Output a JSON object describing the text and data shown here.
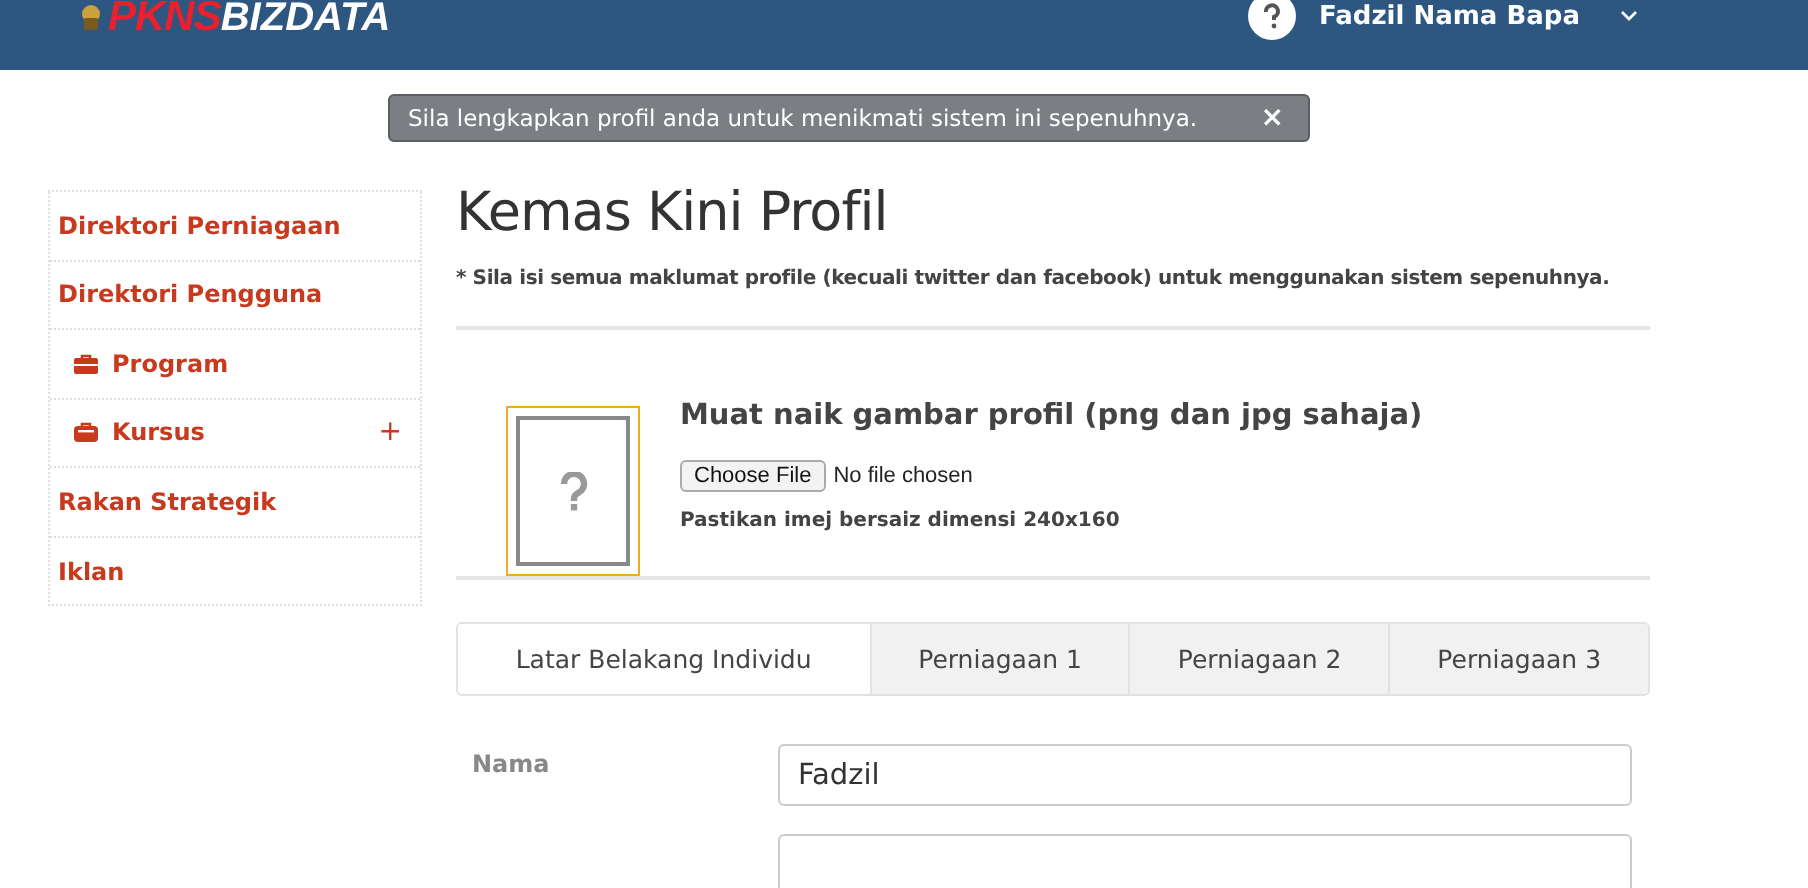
{
  "header": {
    "logo": {
      "brand": "PKNS",
      "product": "BIZDATA"
    },
    "user": {
      "name": "Fadzil Nama Bapa"
    }
  },
  "alert": {
    "message": "Sila lengkapkan profil anda untuk menikmati sistem ini sepenuhnya.",
    "close": "×"
  },
  "sidebar": {
    "items": [
      {
        "label": "Direktori Perniagaan",
        "kind": "plain"
      },
      {
        "label": "Direktori Pengguna",
        "kind": "plain"
      },
      {
        "label": "Program",
        "kind": "briefcase"
      },
      {
        "label": "Kursus",
        "kind": "toolbox",
        "expander": "+"
      },
      {
        "label": "Rakan Strategik",
        "kind": "plain"
      },
      {
        "label": "Iklan",
        "kind": "plain"
      }
    ]
  },
  "page": {
    "title": "Kemas Kini Profil",
    "note": "* Sila isi semua maklumat profile (kecuali twitter dan facebook) untuk menggunakan sistem sepenuhnya."
  },
  "upload": {
    "heading": "Muat naik gambar profil (png dan jpg sahaja)",
    "button": "Choose File",
    "status": "No file chosen",
    "hint": "Pastikan imej bersaiz dimensi 240x160"
  },
  "tabs": [
    {
      "label": "Latar Belakang Individu",
      "selected": true
    },
    {
      "label": "Perniagaan 1",
      "selected": false
    },
    {
      "label": "Perniagaan 2",
      "selected": false
    },
    {
      "label": "Perniagaan 3",
      "selected": false
    }
  ],
  "form": {
    "fields": [
      {
        "label": "Nama",
        "value": "Fadzil"
      }
    ]
  }
}
